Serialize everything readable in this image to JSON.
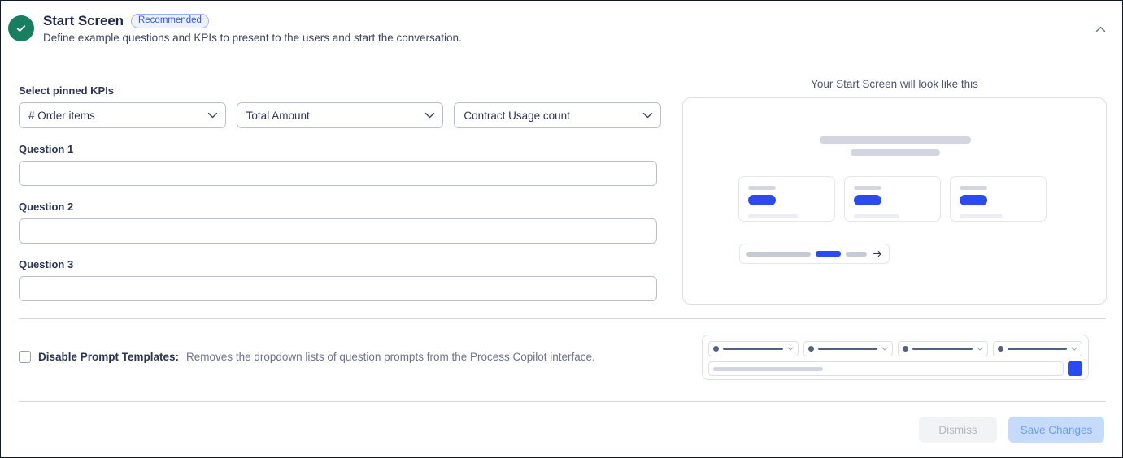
{
  "header": {
    "status_icon": "check-circle-icon",
    "status_color": "#157f5f",
    "title": "Start Screen",
    "badge": "Recommended",
    "subtitle": "Define example questions and KPIs to present to the users and start the conversation.",
    "collapse_icon": "chevron-up-icon"
  },
  "form": {
    "kpi_label": "Select pinned KPIs",
    "kpis": [
      {
        "value": "# Order items"
      },
      {
        "value": "Total Amount"
      },
      {
        "value": "Contract Usage count"
      }
    ],
    "questions": [
      {
        "label": "Question 1",
        "value": "",
        "placeholder": ""
      },
      {
        "label": "Question 2",
        "value": "",
        "placeholder": ""
      },
      {
        "label": "Question 3",
        "value": "",
        "placeholder": ""
      }
    ]
  },
  "preview": {
    "caption": "Your Start Screen will look like this",
    "accent_color": "#2b4af2",
    "placeholder_color": "#d3d6e0",
    "cards_count": 3,
    "send_icon": "arrow-right-icon"
  },
  "options": {
    "disable_prompt_templates": {
      "checked": false,
      "label": "Disable Prompt Templates:",
      "description": "Removes the dropdown lists of question prompts from the Process Copilot interface."
    }
  },
  "footer": {
    "dismiss_label": "Dismiss",
    "save_label": "Save Changes",
    "dismiss_enabled": false,
    "save_enabled": false
  }
}
